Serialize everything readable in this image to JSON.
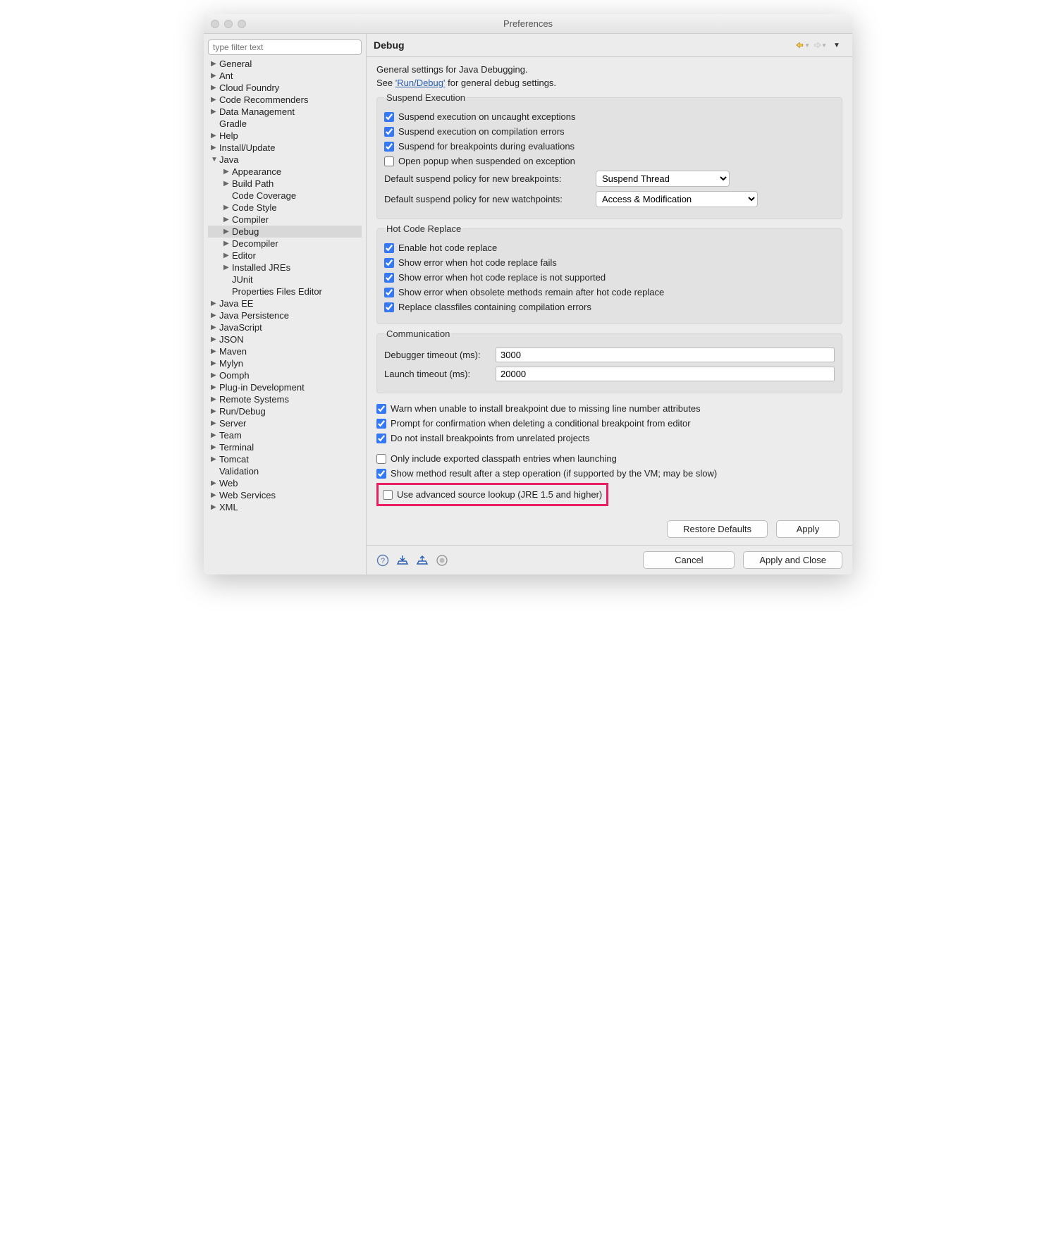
{
  "window": {
    "title": "Preferences"
  },
  "sidebar": {
    "filter_placeholder": "type filter text",
    "items": [
      {
        "label": "General",
        "lvl": 0,
        "arrow": "▶"
      },
      {
        "label": "Ant",
        "lvl": 0,
        "arrow": "▶"
      },
      {
        "label": "Cloud Foundry",
        "lvl": 0,
        "arrow": "▶"
      },
      {
        "label": "Code Recommenders",
        "lvl": 0,
        "arrow": "▶"
      },
      {
        "label": "Data Management",
        "lvl": 0,
        "arrow": "▶"
      },
      {
        "label": "Gradle",
        "lvl": 0,
        "arrow": ""
      },
      {
        "label": "Help",
        "lvl": 0,
        "arrow": "▶"
      },
      {
        "label": "Install/Update",
        "lvl": 0,
        "arrow": "▶"
      },
      {
        "label": "Java",
        "lvl": 0,
        "arrow": "▼"
      },
      {
        "label": "Appearance",
        "lvl": 1,
        "arrow": "▶"
      },
      {
        "label": "Build Path",
        "lvl": 1,
        "arrow": "▶"
      },
      {
        "label": "Code Coverage",
        "lvl": 1,
        "arrow": ""
      },
      {
        "label": "Code Style",
        "lvl": 1,
        "arrow": "▶"
      },
      {
        "label": "Compiler",
        "lvl": 1,
        "arrow": "▶"
      },
      {
        "label": "Debug",
        "lvl": 1,
        "arrow": "▶",
        "selected": true
      },
      {
        "label": "Decompiler",
        "lvl": 1,
        "arrow": "▶"
      },
      {
        "label": "Editor",
        "lvl": 1,
        "arrow": "▶"
      },
      {
        "label": "Installed JREs",
        "lvl": 1,
        "arrow": "▶"
      },
      {
        "label": "JUnit",
        "lvl": 1,
        "arrow": ""
      },
      {
        "label": "Properties Files Editor",
        "lvl": 1,
        "arrow": ""
      },
      {
        "label": "Java EE",
        "lvl": 0,
        "arrow": "▶"
      },
      {
        "label": "Java Persistence",
        "lvl": 0,
        "arrow": "▶"
      },
      {
        "label": "JavaScript",
        "lvl": 0,
        "arrow": "▶"
      },
      {
        "label": "JSON",
        "lvl": 0,
        "arrow": "▶"
      },
      {
        "label": "Maven",
        "lvl": 0,
        "arrow": "▶"
      },
      {
        "label": "Mylyn",
        "lvl": 0,
        "arrow": "▶"
      },
      {
        "label": "Oomph",
        "lvl": 0,
        "arrow": "▶"
      },
      {
        "label": "Plug-in Development",
        "lvl": 0,
        "arrow": "▶"
      },
      {
        "label": "Remote Systems",
        "lvl": 0,
        "arrow": "▶"
      },
      {
        "label": "Run/Debug",
        "lvl": 0,
        "arrow": "▶"
      },
      {
        "label": "Server",
        "lvl": 0,
        "arrow": "▶"
      },
      {
        "label": "Team",
        "lvl": 0,
        "arrow": "▶"
      },
      {
        "label": "Terminal",
        "lvl": 0,
        "arrow": "▶"
      },
      {
        "label": "Tomcat",
        "lvl": 0,
        "arrow": "▶"
      },
      {
        "label": "Validation",
        "lvl": 0,
        "arrow": ""
      },
      {
        "label": "Web",
        "lvl": 0,
        "arrow": "▶"
      },
      {
        "label": "Web Services",
        "lvl": 0,
        "arrow": "▶"
      },
      {
        "label": "XML",
        "lvl": 0,
        "arrow": "▶"
      }
    ]
  },
  "header": {
    "title": "Debug"
  },
  "intro": {
    "line1": "General settings for Java Debugging.",
    "see_prefix": "See ",
    "link": "'Run/Debug'",
    "see_suffix": " for general debug settings."
  },
  "groups": {
    "suspend": {
      "legend": "Suspend Execution",
      "c1": "Suspend execution on uncaught exceptions",
      "c2": "Suspend execution on compilation errors",
      "c3": "Suspend for breakpoints during evaluations",
      "c4": "Open popup when suspended on exception",
      "sel1_label": "Default suspend policy for new breakpoints:",
      "sel1_value": "Suspend Thread",
      "sel2_label": "Default suspend policy for new watchpoints:",
      "sel2_value": "Access & Modification"
    },
    "hcr": {
      "legend": "Hot Code Replace",
      "c1": "Enable hot code replace",
      "c2": "Show error when hot code replace fails",
      "c3": "Show error when hot code replace is not supported",
      "c4": "Show error when obsolete methods remain after hot code replace",
      "c5": "Replace classfiles containing compilation errors"
    },
    "comm": {
      "legend": "Communication",
      "t1_label": "Debugger timeout (ms):",
      "t1_value": "3000",
      "t2_label": "Launch timeout (ms):",
      "t2_value": "20000"
    }
  },
  "misc": {
    "c1": "Warn when unable to install breakpoint due to missing line number attributes",
    "c2": "Prompt for confirmation when deleting a conditional breakpoint from editor",
    "c3": "Do not install breakpoints from unrelated projects",
    "c4": "Only include exported classpath entries when launching",
    "c5": "Show method result after a step operation (if supported by the VM; may be slow)",
    "c6": "Use advanced source lookup (JRE 1.5 and higher)"
  },
  "buttons": {
    "restore": "Restore Defaults",
    "apply": "Apply",
    "cancel": "Cancel",
    "apply_close": "Apply and Close"
  }
}
